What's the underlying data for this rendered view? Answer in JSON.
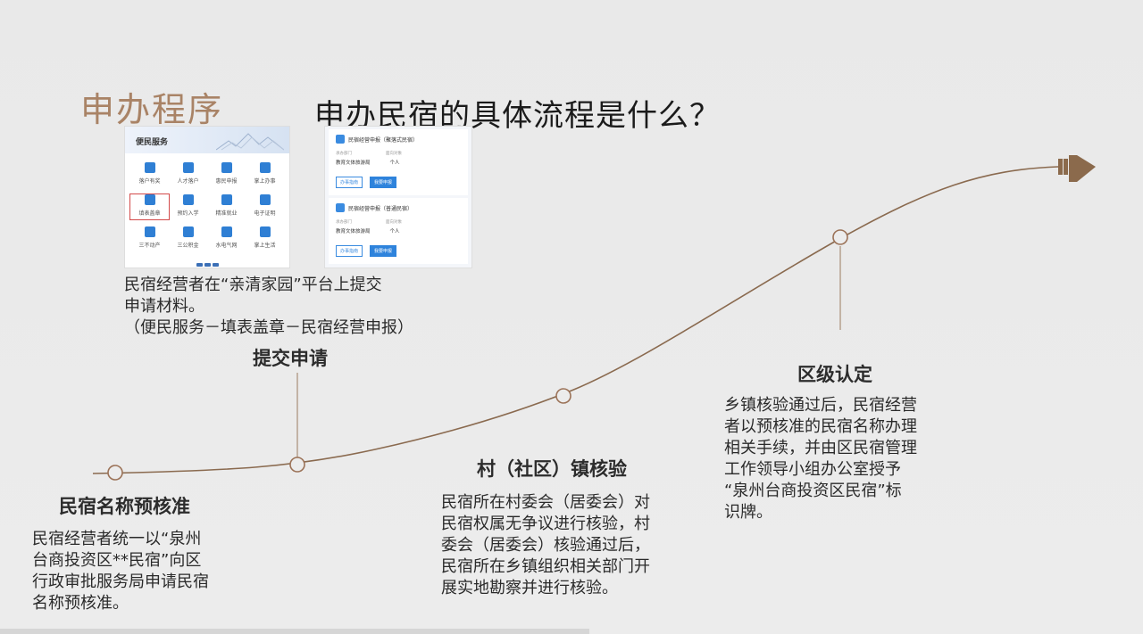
{
  "section_tag": "申办程序",
  "title": "申办民宿的具体流程是什么？",
  "steps": [
    {
      "title": "民宿名称预核准",
      "desc": [
        "民宿经营者统一以“泉州",
        "台商投资区**民宿”向区",
        "行政审批服务局申请民宿",
        "名称预核准。"
      ]
    },
    {
      "title": "提交申请",
      "desc": [
        "民宿经营者在“亲清家园”平台上提交",
        "申请材料。",
        "（便民服务－填表盖章－民宿经营申报）"
      ]
    },
    {
      "title": "村（社区）镇核验",
      "desc": [
        "民宿所在村委会（居委会）对",
        "民宿权属无争议进行核验，村",
        "委会（居委会）核验通过后，",
        "民宿所在乡镇组织相关部门开",
        "展实地勘察并进行核验。"
      ]
    },
    {
      "title": "区级认定",
      "desc": [
        "乡镇核验通过后，民宿经营",
        "者以预核准的民宿名称办理",
        "相关手续，并由区民宿管理",
        "工作领导小组办公室授予",
        "“泉州台商投资区民宿”标",
        "识牌。"
      ]
    }
  ],
  "service_panel": {
    "header": "便民服务",
    "items": [
      {
        "label": "落户有奖",
        "selected": false
      },
      {
        "label": "人才落户",
        "selected": false
      },
      {
        "label": "惠民申报",
        "selected": false
      },
      {
        "label": "掌上办事",
        "selected": false
      },
      {
        "label": "填表盖章",
        "selected": true
      },
      {
        "label": "预约入学",
        "selected": false
      },
      {
        "label": "精准就业",
        "selected": false
      },
      {
        "label": "电子证明",
        "selected": false
      },
      {
        "label": "三不动产",
        "selected": false
      },
      {
        "label": "三公积金",
        "selected": false
      },
      {
        "label": "水电气网",
        "selected": false
      },
      {
        "label": "掌上生活",
        "selected": false
      }
    ]
  },
  "declare_panel": {
    "cards": [
      {
        "title": "民宿经营申报（聚落式民宿）",
        "dept_label": "承办部门",
        "target_label": "面向对象",
        "dept": "教育文体旅游局",
        "target": "个人",
        "guide_btn": "办事指南",
        "apply_btn": "我要申报"
      },
      {
        "title": "民宿经营申报（普通民宿）",
        "dept_label": "承办部门",
        "target_label": "面向对象",
        "dept": "教育文体旅游局",
        "target": "个人",
        "guide_btn": "办事指南",
        "apply_btn": "我要申报"
      }
    ]
  },
  "colors": {
    "accent": "#a98366",
    "curve": "#8a6a4f",
    "arrow": "#8b6a4c",
    "button_blue": "#2e83dc"
  }
}
